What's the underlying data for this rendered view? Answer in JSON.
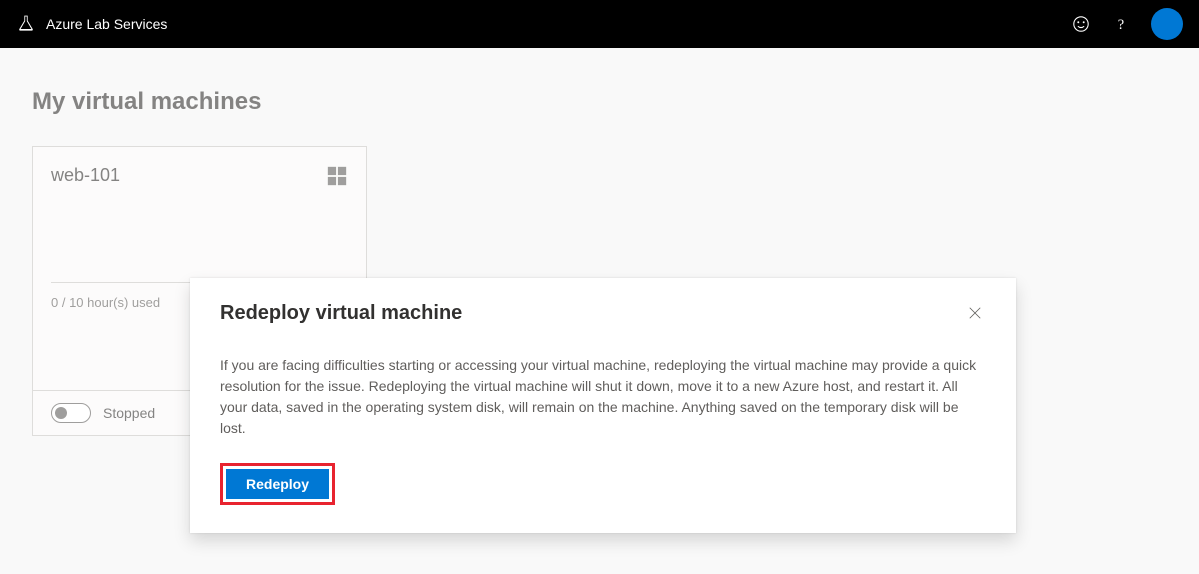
{
  "header": {
    "title": "Azure Lab Services"
  },
  "page": {
    "title": "My virtual machines"
  },
  "vm": {
    "name": "web-101",
    "usage": "0 / 10 hour(s) used",
    "status": "Stopped"
  },
  "dialog": {
    "title": "Redeploy virtual machine",
    "body": "If you are facing difficulties starting or accessing your virtual machine, redeploying the virtual machine may provide a quick resolution for the issue. Redeploying the virtual machine will shut it down, move it to a new Azure host, and restart it. All your data, saved in the operating system disk, will remain on the machine. Anything saved on the temporary disk will be lost.",
    "button": "Redeploy"
  }
}
